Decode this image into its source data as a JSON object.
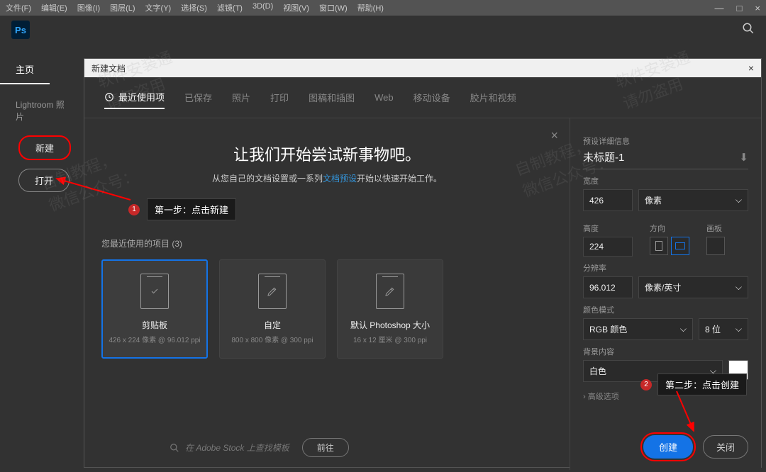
{
  "menubar": [
    "文件(F)",
    "编辑(E)",
    "图像(I)",
    "图层(L)",
    "文字(Y)",
    "选择(S)",
    "滤镜(T)",
    "3D(D)",
    "视图(V)",
    "窗口(W)",
    "帮助(H)"
  ],
  "sidebar": {
    "home_tab": "主页",
    "lightroom": "Lightroom 照片",
    "new_btn": "新建",
    "open_btn": "打开"
  },
  "dialog": {
    "title": "新建文档",
    "tabs": [
      "最近使用项",
      "已保存",
      "照片",
      "打印",
      "图稿和插图",
      "Web",
      "移动设备",
      "胶片和视频"
    ],
    "welcome_title": "让我们开始尝试新事物吧。",
    "welcome_sub_pre": "从您自己的文档设置或一系列",
    "welcome_sub_link": "文档预设",
    "welcome_sub_post": "开始以快速开始工作。",
    "step1_num": "1",
    "step1_text": "第一步：点击新建",
    "recent_label": "您最近使用的项目",
    "recent_count": "(3)",
    "presets": [
      {
        "name": "剪贴板",
        "detail": "426 x 224 像素 @ 96.012 ppi"
      },
      {
        "name": "自定",
        "detail": "800 x 800 像素 @ 300 ppi"
      },
      {
        "name": "默认 Photoshop 大小",
        "detail": "16 x 12 厘米 @ 300 ppi"
      }
    ],
    "stock_placeholder": "在 Adobe Stock 上查找模板",
    "go_btn": "前往"
  },
  "settings": {
    "panel_title": "预设详细信息",
    "doc_name": "未标题-1",
    "width_label": "宽度",
    "width_value": "426",
    "width_unit": "像素",
    "height_label": "高度",
    "height_value": "224",
    "orient_label": "方向",
    "artboard_label": "画板",
    "res_label": "分辨率",
    "res_value": "96.012",
    "res_unit": "像素/英寸",
    "color_label": "颜色模式",
    "color_mode": "RGB 颜色",
    "bit_depth": "8 位",
    "bg_label": "背景内容",
    "bg_value": "白色",
    "advanced": "高级选项",
    "step2_num": "2",
    "step2_text": "第二步：点击创建",
    "create_btn": "创建",
    "close_btn": "关闭"
  },
  "watermark": "软件安装通\n请勿盗用"
}
